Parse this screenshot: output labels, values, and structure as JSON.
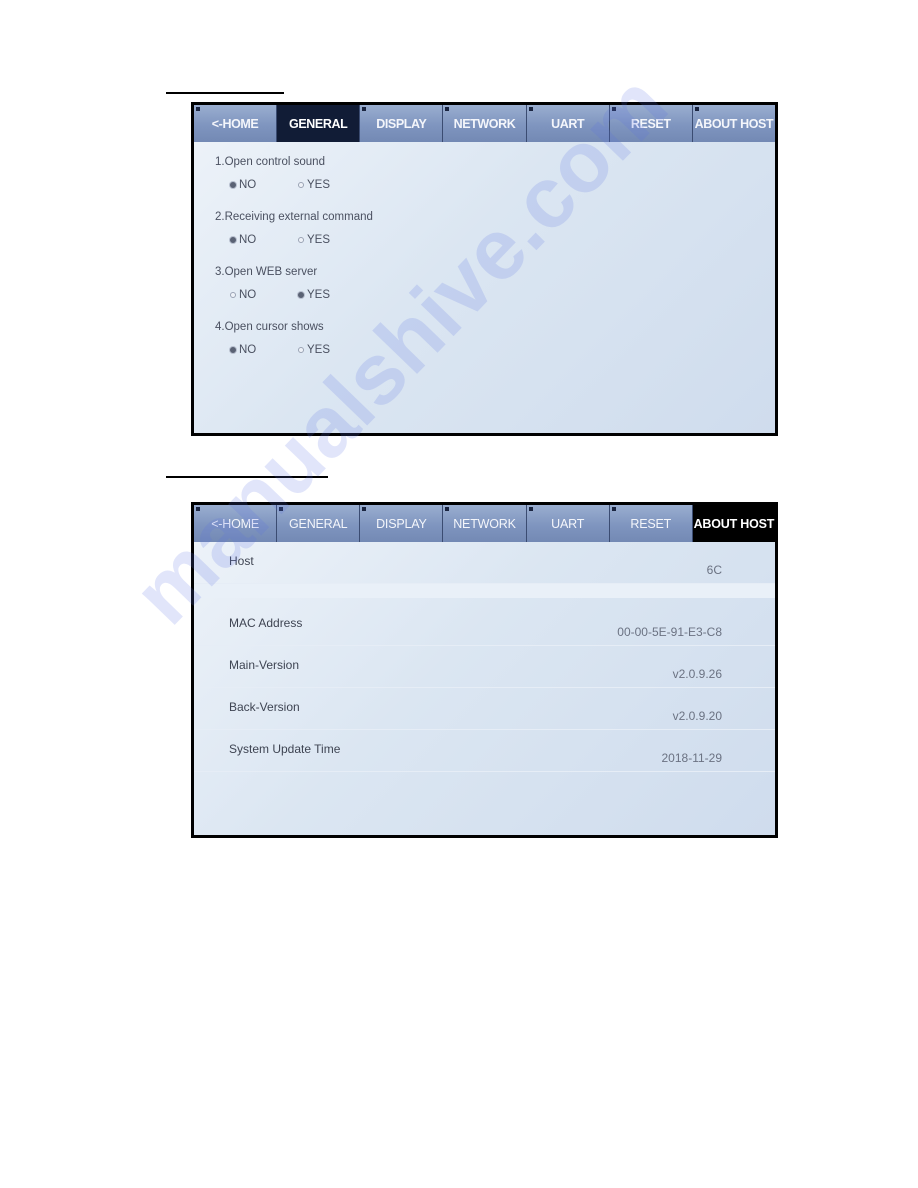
{
  "screens": [
    {
      "tabs": [
        {
          "label": "<-HOME",
          "state": "normal"
        },
        {
          "label": "GENERAL",
          "state": "active"
        },
        {
          "label": "DISPLAY",
          "state": "normal"
        },
        {
          "label": "NETWORK",
          "state": "normal"
        },
        {
          "label": "UART",
          "state": "normal"
        },
        {
          "label": "RESET",
          "state": "normal"
        },
        {
          "label": "ABOUT HOST",
          "state": "normal"
        }
      ],
      "settings": [
        {
          "question": "1.Open control sound",
          "options": [
            "NO",
            "YES"
          ],
          "selected": "NO"
        },
        {
          "question": "2.Receiving external command",
          "options": [
            "NO",
            "YES"
          ],
          "selected": "NO"
        },
        {
          "question": "3.Open WEB server",
          "options": [
            "NO",
            "YES"
          ],
          "selected": "YES"
        },
        {
          "question": "4.Open cursor shows",
          "options": [
            "NO",
            "YES"
          ],
          "selected": "NO"
        }
      ]
    },
    {
      "tabs": [
        {
          "label": "<-HOME",
          "state": "normal"
        },
        {
          "label": "GENERAL",
          "state": "normal"
        },
        {
          "label": "DISPLAY",
          "state": "normal"
        },
        {
          "label": "NETWORK",
          "state": "normal"
        },
        {
          "label": "UART",
          "state": "normal"
        },
        {
          "label": "RESET",
          "state": "normal"
        },
        {
          "label": "ABOUT HOST",
          "state": "active"
        }
      ],
      "info": [
        {
          "label": "Host",
          "value": "6C"
        },
        {
          "label": "MAC Address",
          "value": "00-00-5E-91-E3-C8"
        },
        {
          "label": "Main-Version",
          "value": "v2.0.9.26"
        },
        {
          "label": "Back-Version",
          "value": "v2.0.9.20"
        },
        {
          "label": "System Update Time",
          "value": "2018-11-29"
        }
      ]
    }
  ],
  "watermark": "manualshive.com",
  "colors": {
    "tab_bg": "#7f95bf",
    "tab_active_general": "#111c36",
    "tab_active_about": "#000000",
    "screen_bg": "#dbe6f2",
    "text": "#4a5060"
  }
}
